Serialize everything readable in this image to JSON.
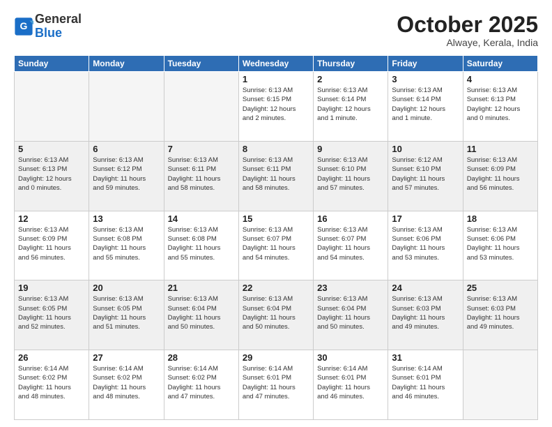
{
  "header": {
    "logo_general": "General",
    "logo_blue": "Blue",
    "month": "October 2025",
    "location": "Alwaye, Kerala, India"
  },
  "days_of_week": [
    "Sunday",
    "Monday",
    "Tuesday",
    "Wednesday",
    "Thursday",
    "Friday",
    "Saturday"
  ],
  "weeks": [
    [
      {
        "day": "",
        "info": ""
      },
      {
        "day": "",
        "info": ""
      },
      {
        "day": "",
        "info": ""
      },
      {
        "day": "1",
        "info": "Sunrise: 6:13 AM\nSunset: 6:15 PM\nDaylight: 12 hours\nand 2 minutes."
      },
      {
        "day": "2",
        "info": "Sunrise: 6:13 AM\nSunset: 6:14 PM\nDaylight: 12 hours\nand 1 minute."
      },
      {
        "day": "3",
        "info": "Sunrise: 6:13 AM\nSunset: 6:14 PM\nDaylight: 12 hours\nand 1 minute."
      },
      {
        "day": "4",
        "info": "Sunrise: 6:13 AM\nSunset: 6:13 PM\nDaylight: 12 hours\nand 0 minutes."
      }
    ],
    [
      {
        "day": "5",
        "info": "Sunrise: 6:13 AM\nSunset: 6:13 PM\nDaylight: 12 hours\nand 0 minutes."
      },
      {
        "day": "6",
        "info": "Sunrise: 6:13 AM\nSunset: 6:12 PM\nDaylight: 11 hours\nand 59 minutes."
      },
      {
        "day": "7",
        "info": "Sunrise: 6:13 AM\nSunset: 6:11 PM\nDaylight: 11 hours\nand 58 minutes."
      },
      {
        "day": "8",
        "info": "Sunrise: 6:13 AM\nSunset: 6:11 PM\nDaylight: 11 hours\nand 58 minutes."
      },
      {
        "day": "9",
        "info": "Sunrise: 6:13 AM\nSunset: 6:10 PM\nDaylight: 11 hours\nand 57 minutes."
      },
      {
        "day": "10",
        "info": "Sunrise: 6:12 AM\nSunset: 6:10 PM\nDaylight: 11 hours\nand 57 minutes."
      },
      {
        "day": "11",
        "info": "Sunrise: 6:13 AM\nSunset: 6:09 PM\nDaylight: 11 hours\nand 56 minutes."
      }
    ],
    [
      {
        "day": "12",
        "info": "Sunrise: 6:13 AM\nSunset: 6:09 PM\nDaylight: 11 hours\nand 56 minutes."
      },
      {
        "day": "13",
        "info": "Sunrise: 6:13 AM\nSunset: 6:08 PM\nDaylight: 11 hours\nand 55 minutes."
      },
      {
        "day": "14",
        "info": "Sunrise: 6:13 AM\nSunset: 6:08 PM\nDaylight: 11 hours\nand 55 minutes."
      },
      {
        "day": "15",
        "info": "Sunrise: 6:13 AM\nSunset: 6:07 PM\nDaylight: 11 hours\nand 54 minutes."
      },
      {
        "day": "16",
        "info": "Sunrise: 6:13 AM\nSunset: 6:07 PM\nDaylight: 11 hours\nand 54 minutes."
      },
      {
        "day": "17",
        "info": "Sunrise: 6:13 AM\nSunset: 6:06 PM\nDaylight: 11 hours\nand 53 minutes."
      },
      {
        "day": "18",
        "info": "Sunrise: 6:13 AM\nSunset: 6:06 PM\nDaylight: 11 hours\nand 53 minutes."
      }
    ],
    [
      {
        "day": "19",
        "info": "Sunrise: 6:13 AM\nSunset: 6:05 PM\nDaylight: 11 hours\nand 52 minutes."
      },
      {
        "day": "20",
        "info": "Sunrise: 6:13 AM\nSunset: 6:05 PM\nDaylight: 11 hours\nand 51 minutes."
      },
      {
        "day": "21",
        "info": "Sunrise: 6:13 AM\nSunset: 6:04 PM\nDaylight: 11 hours\nand 50 minutes."
      },
      {
        "day": "22",
        "info": "Sunrise: 6:13 AM\nSunset: 6:04 PM\nDaylight: 11 hours\nand 50 minutes."
      },
      {
        "day": "23",
        "info": "Sunrise: 6:13 AM\nSunset: 6:04 PM\nDaylight: 11 hours\nand 50 minutes."
      },
      {
        "day": "24",
        "info": "Sunrise: 6:13 AM\nSunset: 6:03 PM\nDaylight: 11 hours\nand 49 minutes."
      },
      {
        "day": "25",
        "info": "Sunrise: 6:13 AM\nSunset: 6:03 PM\nDaylight: 11 hours\nand 49 minutes."
      }
    ],
    [
      {
        "day": "26",
        "info": "Sunrise: 6:14 AM\nSunset: 6:02 PM\nDaylight: 11 hours\nand 48 minutes."
      },
      {
        "day": "27",
        "info": "Sunrise: 6:14 AM\nSunset: 6:02 PM\nDaylight: 11 hours\nand 48 minutes."
      },
      {
        "day": "28",
        "info": "Sunrise: 6:14 AM\nSunset: 6:02 PM\nDaylight: 11 hours\nand 47 minutes."
      },
      {
        "day": "29",
        "info": "Sunrise: 6:14 AM\nSunset: 6:01 PM\nDaylight: 11 hours\nand 47 minutes."
      },
      {
        "day": "30",
        "info": "Sunrise: 6:14 AM\nSunset: 6:01 PM\nDaylight: 11 hours\nand 46 minutes."
      },
      {
        "day": "31",
        "info": "Sunrise: 6:14 AM\nSunset: 6:01 PM\nDaylight: 11 hours\nand 46 minutes."
      },
      {
        "day": "",
        "info": ""
      }
    ]
  ]
}
